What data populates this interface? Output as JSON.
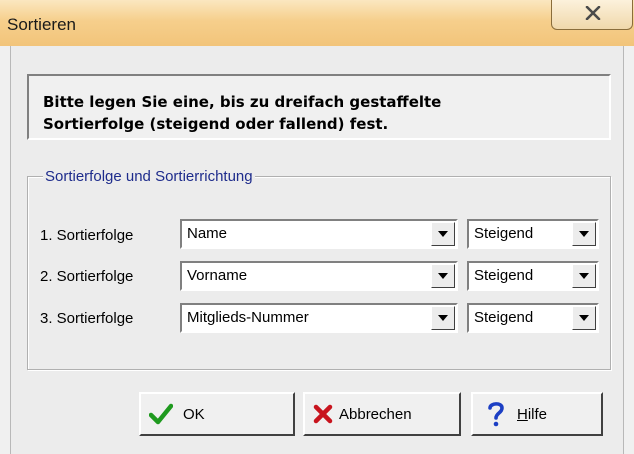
{
  "window": {
    "title": "Sortieren"
  },
  "info": {
    "line1": "Bitte legen Sie eine, bis zu dreifach gestaffelte",
    "line2": "Sortierfolge (steigend oder fallend) fest."
  },
  "group": {
    "legend": "Sortierfolge und Sortierrichtung",
    "rows": [
      {
        "label": "1. Sortierfolge",
        "field": "Name",
        "direction": "Steigend"
      },
      {
        "label": "2. Sortierfolge",
        "field": "Vorname",
        "direction": "Steigend"
      },
      {
        "label": "3. Sortierfolge",
        "field": "Mitglieds-Nummer",
        "direction": "Steigend"
      }
    ]
  },
  "buttons": {
    "ok": "OK",
    "cancel": "Abbrechen",
    "help_mnemonic": "H",
    "help_rest": "ilfe"
  },
  "icons": {
    "close": "close-icon",
    "ok": "checkmark-icon",
    "cancel": "red-x-icon",
    "help": "question-mark-icon",
    "dropdown": "chevron-down-icon"
  }
}
